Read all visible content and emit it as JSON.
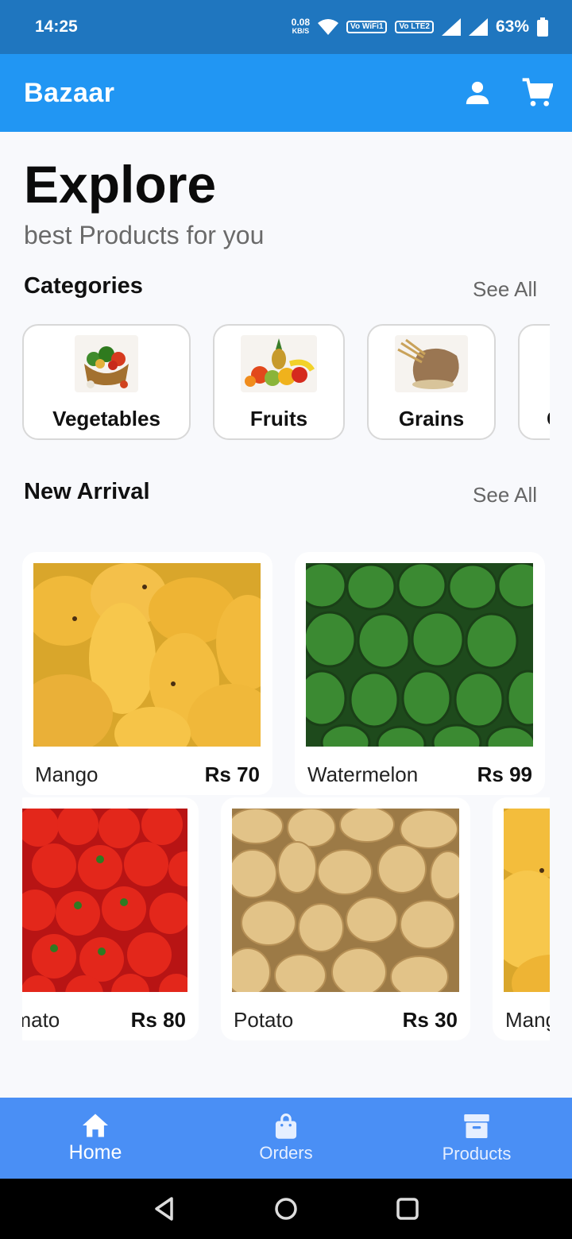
{
  "status": {
    "time": "14:25",
    "speed_value": "0.08",
    "speed_unit": "KB/S",
    "chip1": "Vo WiFi1",
    "chip2": "Vo LTE2",
    "battery": "63%"
  },
  "appbar": {
    "title": "Bazaar",
    "icons": [
      "person-icon",
      "cart-icon"
    ]
  },
  "hero": {
    "title": "Explore",
    "subtitle": "best Products for you"
  },
  "categories": {
    "title": "Categories",
    "see_all": "See All",
    "items": [
      {
        "label": "Vegetables"
      },
      {
        "label": "Fruits"
      },
      {
        "label": "Grains"
      },
      {
        "label": "C"
      }
    ]
  },
  "new_arrival": {
    "title": "New Arrival",
    "see_all": "See All",
    "row1": [
      {
        "name": "Mango",
        "price": "Rs 70"
      },
      {
        "name": "Watermelon",
        "price": "Rs 99"
      }
    ],
    "row2": [
      {
        "name": "Tomato",
        "price": "Rs 80"
      },
      {
        "name": "Potato",
        "price": "Rs 30"
      },
      {
        "name": "Mango",
        "price": ""
      }
    ]
  },
  "bottom_nav": [
    {
      "label": "Home",
      "icon": "home-icon",
      "active": true
    },
    {
      "label": "Orders",
      "icon": "shopping-bag-icon",
      "active": false
    },
    {
      "label": "Products",
      "icon": "archive-box-icon",
      "active": false
    }
  ],
  "colors": {
    "appbar": "#2196f3",
    "statusbar": "#1f76bf",
    "bottom_nav": "#4a8ff5"
  }
}
